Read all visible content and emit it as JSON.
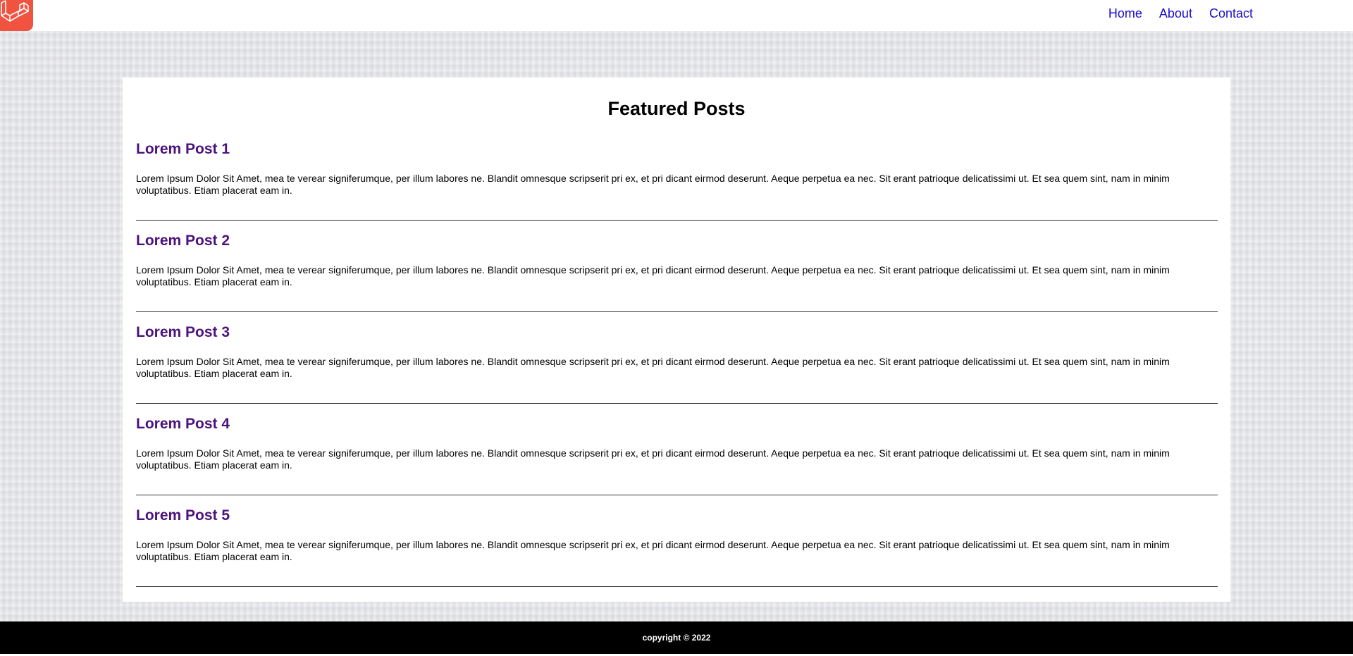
{
  "header": {
    "logo_icon": "laravel-logo-icon",
    "nav": [
      {
        "label": "Home"
      },
      {
        "label": "About"
      },
      {
        "label": "Contact"
      }
    ]
  },
  "main": {
    "title": "Featured Posts",
    "posts": [
      {
        "title": "Lorem Post 1",
        "body": "Lorem Ipsum Dolor Sit Amet, mea te verear signiferumque, per illum labores ne. Blandit omnesque scripserit pri ex, et pri dicant eirmod deserunt. Aeque perpetua ea nec. Sit erant patrioque delicatissimi ut. Et sea quem sint, nam in minim voluptatibus. Etiam placerat eam in."
      },
      {
        "title": "Lorem Post 2",
        "body": "Lorem Ipsum Dolor Sit Amet, mea te verear signiferumque, per illum labores ne. Blandit omnesque scripserit pri ex, et pri dicant eirmod deserunt. Aeque perpetua ea nec. Sit erant patrioque delicatissimi ut. Et sea quem sint, nam in minim voluptatibus. Etiam placerat eam in."
      },
      {
        "title": "Lorem Post 3",
        "body": "Lorem Ipsum Dolor Sit Amet, mea te verear signiferumque, per illum labores ne. Blandit omnesque scripserit pri ex, et pri dicant eirmod deserunt. Aeque perpetua ea nec. Sit erant patrioque delicatissimi ut. Et sea quem sint, nam in minim voluptatibus. Etiam placerat eam in."
      },
      {
        "title": "Lorem Post 4",
        "body": "Lorem Ipsum Dolor Sit Amet, mea te verear signiferumque, per illum labores ne. Blandit omnesque scripserit pri ex, et pri dicant eirmod deserunt. Aeque perpetua ea nec. Sit erant patrioque delicatissimi ut. Et sea quem sint, nam in minim voluptatibus. Etiam placerat eam in."
      },
      {
        "title": "Lorem Post 5",
        "body": "Lorem Ipsum Dolor Sit Amet, mea te verear signiferumque, per illum labores ne. Blandit omnesque scripserit pri ex, et pri dicant eirmod deserunt. Aeque perpetua ea nec. Sit erant patrioque delicatissimi ut. Et sea quem sint, nam in minim voluptatibus. Etiam placerat eam in."
      }
    ]
  },
  "footer": {
    "copyright": "copyright © 2022"
  },
  "colors": {
    "logo_bg": "#f05340",
    "nav_link": "#1a0dcc",
    "post_title": "#4b137d",
    "footer_bg": "#000000"
  }
}
